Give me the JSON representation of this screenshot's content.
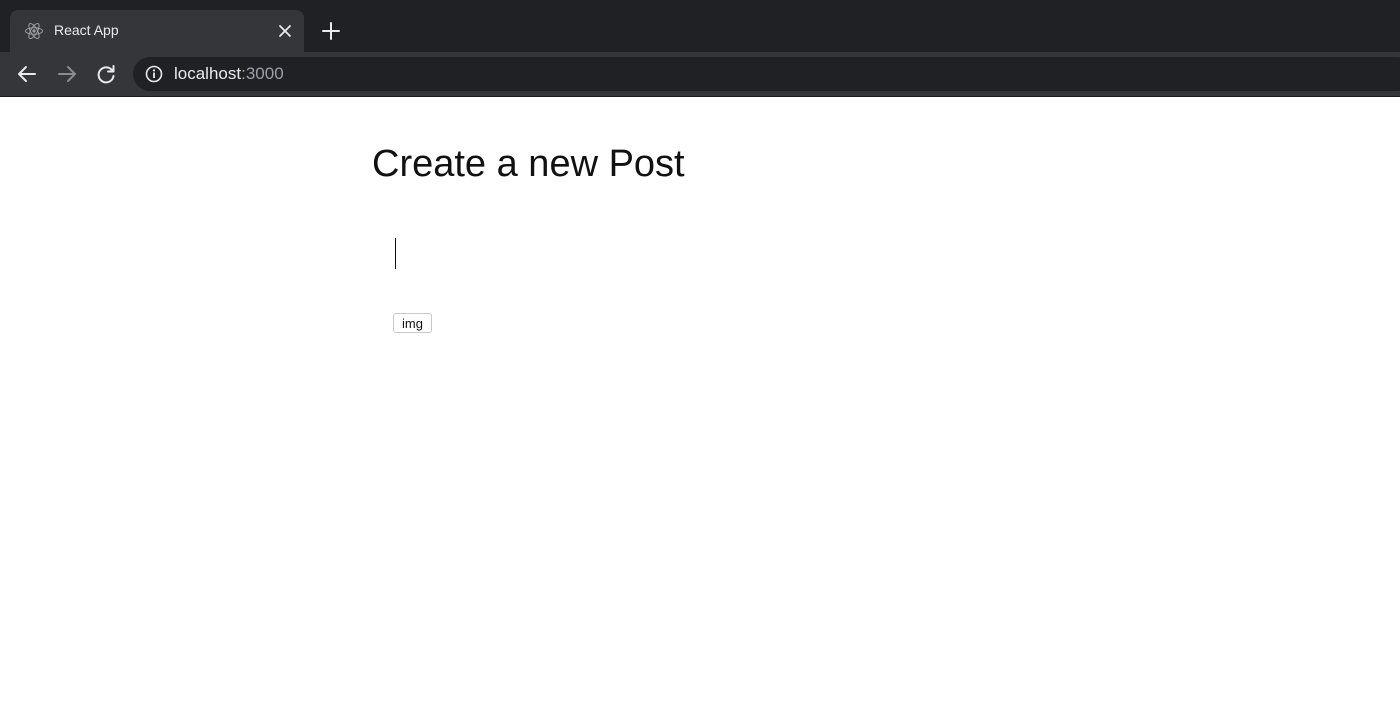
{
  "browser": {
    "tab": {
      "title": "React App",
      "favicon": "react-logo-icon"
    },
    "toolbar": {
      "url_host": "localhost",
      "url_port": ":3000"
    },
    "colors": {
      "tabstrip_bg": "#202124",
      "toolbar_bg": "#35363a",
      "omnibox_bg": "#202124",
      "text_light": "#e8eaed",
      "text_muted": "#9aa0a6"
    }
  },
  "page": {
    "title": "Create a new Post",
    "editor": {
      "value": ""
    },
    "img_button_label": "img"
  }
}
